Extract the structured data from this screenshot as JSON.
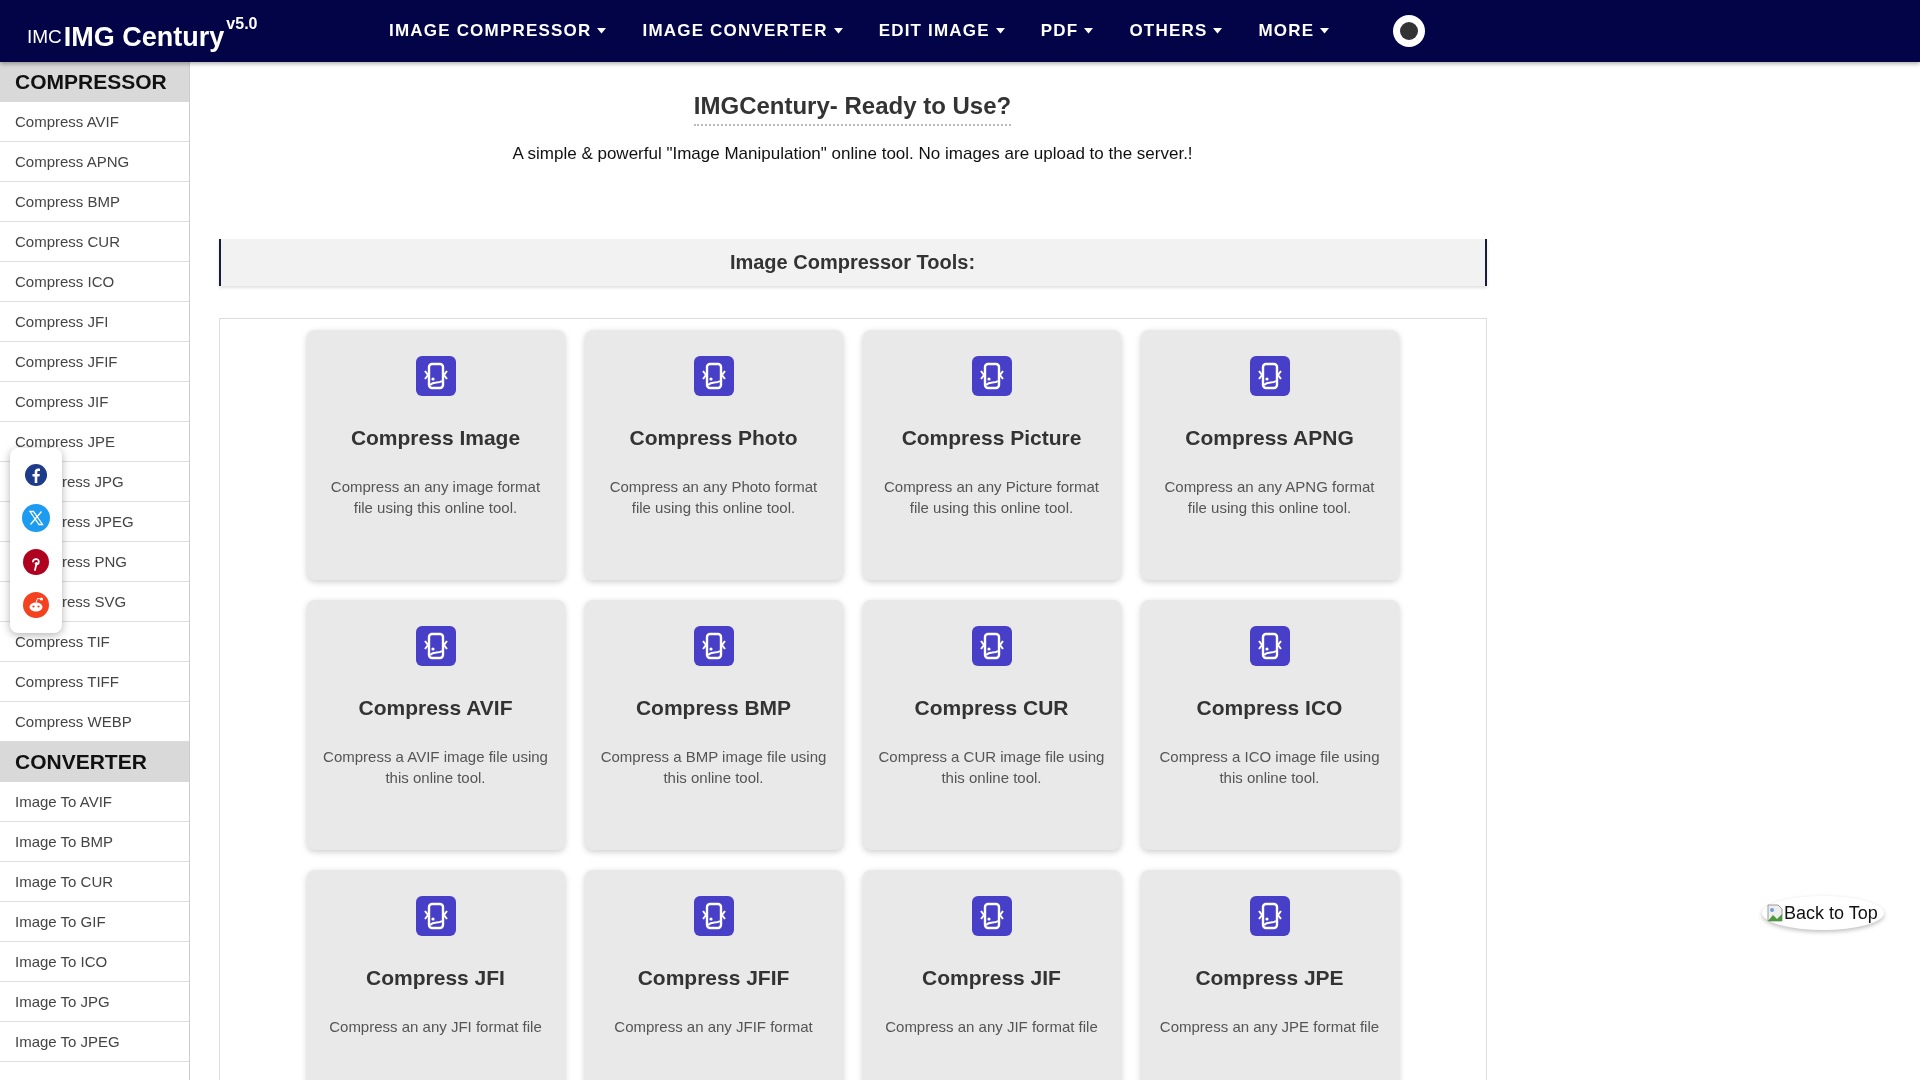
{
  "header": {
    "logo_alt": "IMC",
    "brand": "IMG Century",
    "version": "v5.0",
    "nav": [
      {
        "label": "IMAGE COMPRESSOR"
      },
      {
        "label": "IMAGE CONVERTER"
      },
      {
        "label": "EDIT IMAGE"
      },
      {
        "label": "PDF"
      },
      {
        "label": "OTHERS"
      },
      {
        "label": "MORE"
      }
    ]
  },
  "sidebar": [
    {
      "heading": "COMPRESSOR",
      "items": [
        {
          "label": "Compress AVIF",
          "covered": false
        },
        {
          "label": "Compress APNG",
          "covered": false
        },
        {
          "label": "Compress BMP",
          "covered": false
        },
        {
          "label": "Compress CUR",
          "covered": false
        },
        {
          "label": "Compress ICO",
          "covered": false
        },
        {
          "label": "Compress JFI",
          "covered": false
        },
        {
          "label": "Compress JFIF",
          "covered": false
        },
        {
          "label": "Compress JIF",
          "covered": false
        },
        {
          "label": "Compress JPE",
          "covered": false
        },
        {
          "label": "ress JPG",
          "covered": true
        },
        {
          "label": "ress JPEG",
          "covered": true
        },
        {
          "label": "ress PNG",
          "covered": true
        },
        {
          "label": "ress SVG",
          "covered": true
        },
        {
          "label": "Compress TIF",
          "covered": false
        },
        {
          "label": "Compress TIFF",
          "covered": false
        },
        {
          "label": "Compress WEBP",
          "covered": false
        }
      ]
    },
    {
      "heading": "CONVERTER",
      "items": [
        {
          "label": "Image To AVIF",
          "covered": false
        },
        {
          "label": "Image To BMP",
          "covered": false
        },
        {
          "label": "Image To CUR",
          "covered": false
        },
        {
          "label": "Image To GIF",
          "covered": false
        },
        {
          "label": "Image To ICO",
          "covered": false
        },
        {
          "label": "Image To JPG",
          "covered": false
        },
        {
          "label": "Image To JPEG",
          "covered": false
        }
      ]
    }
  ],
  "social": [
    {
      "kind": "facebook"
    },
    {
      "kind": "x"
    },
    {
      "kind": "pinterest"
    },
    {
      "kind": "reddit"
    }
  ],
  "main": {
    "title": "IMGCentury- Ready to Use?",
    "subtitle": "A simple & powerful \"Image Manipulation\" online tool. No images are upload to the server.!",
    "section_title": "Image Compressor Tools:",
    "cards": [
      {
        "title": "Compress Image",
        "description": "Compress an any image format file using this online tool."
      },
      {
        "title": "Compress Photo",
        "description": "Compress an any Photo format file using this online tool."
      },
      {
        "title": "Compress Picture",
        "description": "Compress an any Picture format file using this online tool."
      },
      {
        "title": "Compress APNG",
        "description": "Compress an any APNG format file using this online tool."
      },
      {
        "title": "Compress AVIF",
        "description": "Compress a AVIF image file using this online tool."
      },
      {
        "title": "Compress BMP",
        "description": "Compress a BMP image file using this online tool."
      },
      {
        "title": "Compress CUR",
        "description": "Compress a CUR image file using this online tool."
      },
      {
        "title": "Compress ICO",
        "description": "Compress a ICO image file using this online tool."
      },
      {
        "title": "Compress JFI",
        "description": "Compress an any JFI format file"
      },
      {
        "title": "Compress JFIF",
        "description": "Compress an any JFIF format"
      },
      {
        "title": "Compress JIF",
        "description": "Compress an any JIF format file"
      },
      {
        "title": "Compress JPE",
        "description": "Compress an any JPE format file"
      }
    ]
  },
  "back_to_top": "Back to Top"
}
